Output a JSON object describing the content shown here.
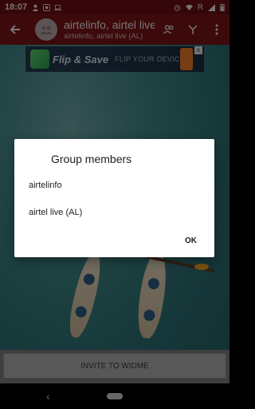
{
  "status_bar": {
    "time": "18:07",
    "left_icons": [
      "person-icon",
      "app-icon",
      "laptop-icon"
    ],
    "right_icons": [
      "alarm-icon",
      "wifi-icon",
      "r-icon",
      "signal-icon",
      "battery-icon"
    ],
    "roaming_label": "R"
  },
  "app_bar": {
    "title": "airtelinfo, airtel live (AL)",
    "subtitle": "airtelinfo, airtel live (AL)",
    "colors": {
      "status_bar": "#6b0f14",
      "app_bar": "#7a1419"
    }
  },
  "ad": {
    "brand": "Flip & Save",
    "tagline": "FLIP YOUR DEVICE",
    "close_label": "x"
  },
  "invite": {
    "label": "INVITE TO WIDME"
  },
  "dialog": {
    "title": "Group members",
    "members": [
      "airtelinfo",
      "airtel live (AL)"
    ],
    "ok_label": "OK"
  },
  "nav_bar": {
    "back_glyph": "‹"
  }
}
